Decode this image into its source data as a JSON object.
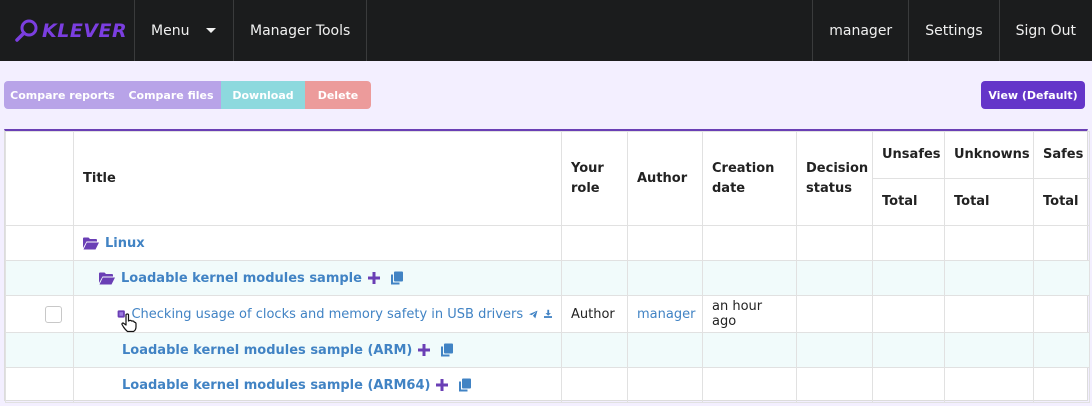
{
  "brand": {
    "name": "KLEVER"
  },
  "nav": {
    "menu_label": "Menu",
    "manager_tools_label": "Manager Tools",
    "user_label": "manager",
    "settings_label": "Settings",
    "sign_out_label": "Sign Out"
  },
  "toolbar": {
    "compare_reports": "Compare reports",
    "compare_files": "Compare files",
    "download": "Download",
    "delete": "Delete",
    "view": "View (Default)"
  },
  "colors": {
    "accent": "#6435c9",
    "link": "#4183c4",
    "navbar": "#1b1c1d",
    "download": "#8dd9de",
    "delete": "#ec9b9b"
  },
  "table": {
    "headers": {
      "title": "Title",
      "your_role": "Your role",
      "author": "Author",
      "creation_date": "Creation date",
      "decision_status": "Decision status",
      "unsafes": "Unsafes",
      "unknowns": "Unknowns",
      "safes": "Safes",
      "total": "Total"
    },
    "rows": [
      {
        "title": "Linux",
        "icon": "folder-open-icon",
        "role": "",
        "author": "",
        "date": ""
      },
      {
        "title": "Loadable kernel modules sample",
        "icon": "folder-open-icon",
        "role": "",
        "author": "",
        "date": ""
      },
      {
        "title": "Checking usage of clocks and memory safety in USB drivers",
        "icon": "job-icon",
        "role": "Author",
        "author": "manager",
        "date": "an hour ago"
      },
      {
        "title": "Loadable kernel modules sample (ARM)",
        "icon": "",
        "role": "",
        "author": "",
        "date": ""
      },
      {
        "title": "Loadable kernel modules sample (ARM64)",
        "icon": "",
        "role": "",
        "author": "",
        "date": ""
      }
    ]
  }
}
